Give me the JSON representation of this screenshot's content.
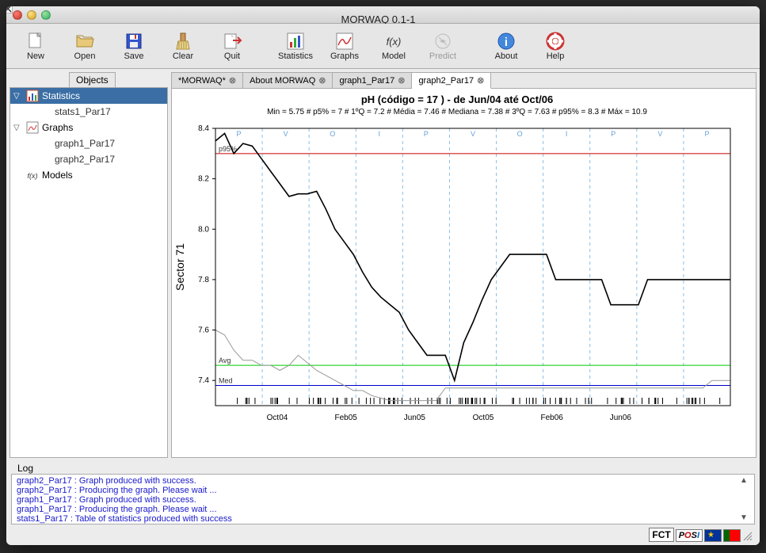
{
  "window": {
    "title": "MORWAQ 0.1-1"
  },
  "toolbar": [
    {
      "id": "new",
      "label": "New",
      "interact": true
    },
    {
      "id": "open",
      "label": "Open",
      "interact": true
    },
    {
      "id": "save",
      "label": "Save",
      "interact": true
    },
    {
      "id": "clear",
      "label": "Clear",
      "interact": true
    },
    {
      "id": "quit",
      "label": "Quit",
      "interact": true
    },
    {
      "id": "gap",
      "label": "",
      "interact": false
    },
    {
      "id": "statistics",
      "label": "Statistics",
      "interact": true
    },
    {
      "id": "graphs",
      "label": "Graphs",
      "interact": true
    },
    {
      "id": "model",
      "label": "Model",
      "interact": true
    },
    {
      "id": "predict",
      "label": "Predict",
      "interact": false
    },
    {
      "id": "gap2",
      "label": "",
      "interact": false
    },
    {
      "id": "about",
      "label": "About",
      "interact": true
    },
    {
      "id": "help",
      "label": "Help",
      "interact": true
    }
  ],
  "objects_header": "Objects",
  "tree": {
    "statistics": {
      "label": "Statistics",
      "children": [
        "stats1_Par17"
      ]
    },
    "graphs": {
      "label": "Graphs",
      "children": [
        "graph1_Par17",
        "graph2_Par17"
      ]
    },
    "models": {
      "label": "Models"
    }
  },
  "tabs": [
    {
      "label": "*MORWAQ*",
      "active": false
    },
    {
      "label": "About MORWAQ",
      "active": false
    },
    {
      "label": "graph1_Par17",
      "active": false
    },
    {
      "label": "graph2_Par17",
      "active": true
    }
  ],
  "log": [
    "graph2_Par17 : Graph produced with success.",
    "graph2_Par17 : Producing the graph.  Please wait ...",
    "graph1_Par17 : Graph produced with success.",
    "graph1_Par17 : Producing the graph.  Please wait ...",
    "stats1_Par17 : Table of statistics produced with success"
  ],
  "log_label": "Log",
  "footer_logos": [
    "FCT",
    "POSI",
    "EU",
    "PT"
  ],
  "chart_data": {
    "type": "line",
    "title": "pH (código =  17 )   -   de Jun/04 até Oct/06",
    "subtitle": "Min = 5.75 # p5% = 7 # 1ºQ = 7.2 # Média = 7.46 # Mediana = 7.38 # 3ºQ = 7.63 # p95% = 8.3 # Máx = 10.9",
    "ylabel": "Sector 71",
    "xlabel": "",
    "ylim": [
      7.3,
      8.4
    ],
    "yticks": [
      7.4,
      7.6,
      7.8,
      8.0,
      8.2,
      8.4
    ],
    "xticks": [
      "Oct04",
      "Feb05",
      "Jun05",
      "Oct05",
      "Feb06",
      "Jun06"
    ],
    "ref_lines": {
      "p95%": 8.3,
      "Avg": 7.46,
      "Med": 7.38
    },
    "period_markers": [
      "P",
      "V",
      "O",
      "I",
      "P",
      "V",
      "O",
      "I",
      "P",
      "V",
      "P"
    ],
    "series": [
      {
        "name": "main",
        "color": "#000",
        "values": [
          8.35,
          8.38,
          8.3,
          8.34,
          8.33,
          8.28,
          8.23,
          8.18,
          8.13,
          8.14,
          8.14,
          8.15,
          8.08,
          8.0,
          7.95,
          7.9,
          7.83,
          7.77,
          7.73,
          7.7,
          7.67,
          7.6,
          7.55,
          7.5,
          7.5,
          7.5,
          7.4,
          7.55,
          7.63,
          7.72,
          7.8,
          7.85,
          7.9,
          7.9,
          7.9,
          7.9,
          7.9,
          7.8,
          7.8,
          7.8,
          7.8,
          7.8,
          7.8,
          7.7,
          7.7,
          7.7,
          7.7,
          7.8,
          7.8,
          7.8,
          7.8,
          7.8,
          7.8,
          7.8,
          7.8,
          7.8,
          7.8
        ]
      },
      {
        "name": "secondary",
        "color": "#999",
        "values": [
          7.6,
          7.58,
          7.52,
          7.48,
          7.48,
          7.46,
          7.46,
          7.44,
          7.46,
          7.5,
          7.47,
          7.44,
          7.42,
          7.4,
          7.38,
          7.36,
          7.36,
          7.34,
          7.33,
          7.32,
          7.32,
          7.32,
          7.32,
          7.32,
          7.32,
          7.37,
          7.37,
          7.37,
          7.37,
          7.37,
          7.37,
          7.37,
          7.37,
          7.37,
          7.37,
          7.37,
          7.37,
          7.37,
          7.37,
          7.37,
          7.37,
          7.37,
          7.37,
          7.37,
          7.37,
          7.37,
          7.37,
          7.37,
          7.37,
          7.37,
          7.37,
          7.37,
          7.37,
          7.37,
          7.4,
          7.4,
          7.4
        ]
      }
    ]
  }
}
